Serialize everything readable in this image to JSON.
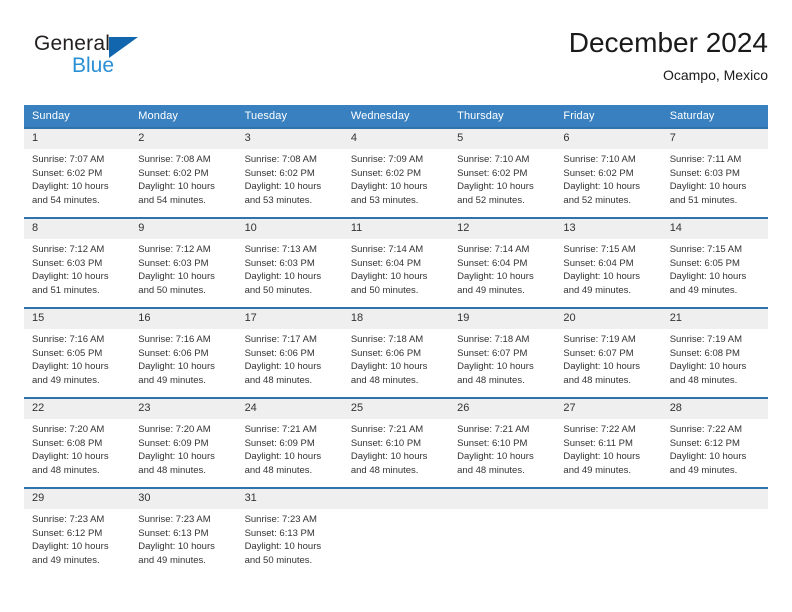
{
  "brand": {
    "name_top": "General",
    "name_bottom": "Blue",
    "triangle_color": "#1266ad",
    "blue_text_color": "#2a8fd4"
  },
  "header": {
    "title": "December 2024",
    "subtitle": "Ocampo, Mexico"
  },
  "theme": {
    "header_row_bg": "#3880c0",
    "cell_top_border": "#2f72ac",
    "daynum_bg": "#efefef",
    "text": "#333333"
  },
  "weekdays": [
    "Sunday",
    "Monday",
    "Tuesday",
    "Wednesday",
    "Thursday",
    "Friday",
    "Saturday"
  ],
  "weeks": [
    [
      {
        "day": "1",
        "sunrise": "Sunrise: 7:07 AM",
        "sunset": "Sunset: 6:02 PM",
        "daylight_1": "Daylight: 10 hours",
        "daylight_2": "and 54 minutes."
      },
      {
        "day": "2",
        "sunrise": "Sunrise: 7:08 AM",
        "sunset": "Sunset: 6:02 PM",
        "daylight_1": "Daylight: 10 hours",
        "daylight_2": "and 54 minutes."
      },
      {
        "day": "3",
        "sunrise": "Sunrise: 7:08 AM",
        "sunset": "Sunset: 6:02 PM",
        "daylight_1": "Daylight: 10 hours",
        "daylight_2": "and 53 minutes."
      },
      {
        "day": "4",
        "sunrise": "Sunrise: 7:09 AM",
        "sunset": "Sunset: 6:02 PM",
        "daylight_1": "Daylight: 10 hours",
        "daylight_2": "and 53 minutes."
      },
      {
        "day": "5",
        "sunrise": "Sunrise: 7:10 AM",
        "sunset": "Sunset: 6:02 PM",
        "daylight_1": "Daylight: 10 hours",
        "daylight_2": "and 52 minutes."
      },
      {
        "day": "6",
        "sunrise": "Sunrise: 7:10 AM",
        "sunset": "Sunset: 6:02 PM",
        "daylight_1": "Daylight: 10 hours",
        "daylight_2": "and 52 minutes."
      },
      {
        "day": "7",
        "sunrise": "Sunrise: 7:11 AM",
        "sunset": "Sunset: 6:03 PM",
        "daylight_1": "Daylight: 10 hours",
        "daylight_2": "and 51 minutes."
      }
    ],
    [
      {
        "day": "8",
        "sunrise": "Sunrise: 7:12 AM",
        "sunset": "Sunset: 6:03 PM",
        "daylight_1": "Daylight: 10 hours",
        "daylight_2": "and 51 minutes."
      },
      {
        "day": "9",
        "sunrise": "Sunrise: 7:12 AM",
        "sunset": "Sunset: 6:03 PM",
        "daylight_1": "Daylight: 10 hours",
        "daylight_2": "and 50 minutes."
      },
      {
        "day": "10",
        "sunrise": "Sunrise: 7:13 AM",
        "sunset": "Sunset: 6:03 PM",
        "daylight_1": "Daylight: 10 hours",
        "daylight_2": "and 50 minutes."
      },
      {
        "day": "11",
        "sunrise": "Sunrise: 7:14 AM",
        "sunset": "Sunset: 6:04 PM",
        "daylight_1": "Daylight: 10 hours",
        "daylight_2": "and 50 minutes."
      },
      {
        "day": "12",
        "sunrise": "Sunrise: 7:14 AM",
        "sunset": "Sunset: 6:04 PM",
        "daylight_1": "Daylight: 10 hours",
        "daylight_2": "and 49 minutes."
      },
      {
        "day": "13",
        "sunrise": "Sunrise: 7:15 AM",
        "sunset": "Sunset: 6:04 PM",
        "daylight_1": "Daylight: 10 hours",
        "daylight_2": "and 49 minutes."
      },
      {
        "day": "14",
        "sunrise": "Sunrise: 7:15 AM",
        "sunset": "Sunset: 6:05 PM",
        "daylight_1": "Daylight: 10 hours",
        "daylight_2": "and 49 minutes."
      }
    ],
    [
      {
        "day": "15",
        "sunrise": "Sunrise: 7:16 AM",
        "sunset": "Sunset: 6:05 PM",
        "daylight_1": "Daylight: 10 hours",
        "daylight_2": "and 49 minutes."
      },
      {
        "day": "16",
        "sunrise": "Sunrise: 7:16 AM",
        "sunset": "Sunset: 6:06 PM",
        "daylight_1": "Daylight: 10 hours",
        "daylight_2": "and 49 minutes."
      },
      {
        "day": "17",
        "sunrise": "Sunrise: 7:17 AM",
        "sunset": "Sunset: 6:06 PM",
        "daylight_1": "Daylight: 10 hours",
        "daylight_2": "and 48 minutes."
      },
      {
        "day": "18",
        "sunrise": "Sunrise: 7:18 AM",
        "sunset": "Sunset: 6:06 PM",
        "daylight_1": "Daylight: 10 hours",
        "daylight_2": "and 48 minutes."
      },
      {
        "day": "19",
        "sunrise": "Sunrise: 7:18 AM",
        "sunset": "Sunset: 6:07 PM",
        "daylight_1": "Daylight: 10 hours",
        "daylight_2": "and 48 minutes."
      },
      {
        "day": "20",
        "sunrise": "Sunrise: 7:19 AM",
        "sunset": "Sunset: 6:07 PM",
        "daylight_1": "Daylight: 10 hours",
        "daylight_2": "and 48 minutes."
      },
      {
        "day": "21",
        "sunrise": "Sunrise: 7:19 AM",
        "sunset": "Sunset: 6:08 PM",
        "daylight_1": "Daylight: 10 hours",
        "daylight_2": "and 48 minutes."
      }
    ],
    [
      {
        "day": "22",
        "sunrise": "Sunrise: 7:20 AM",
        "sunset": "Sunset: 6:08 PM",
        "daylight_1": "Daylight: 10 hours",
        "daylight_2": "and 48 minutes."
      },
      {
        "day": "23",
        "sunrise": "Sunrise: 7:20 AM",
        "sunset": "Sunset: 6:09 PM",
        "daylight_1": "Daylight: 10 hours",
        "daylight_2": "and 48 minutes."
      },
      {
        "day": "24",
        "sunrise": "Sunrise: 7:21 AM",
        "sunset": "Sunset: 6:09 PM",
        "daylight_1": "Daylight: 10 hours",
        "daylight_2": "and 48 minutes."
      },
      {
        "day": "25",
        "sunrise": "Sunrise: 7:21 AM",
        "sunset": "Sunset: 6:10 PM",
        "daylight_1": "Daylight: 10 hours",
        "daylight_2": "and 48 minutes."
      },
      {
        "day": "26",
        "sunrise": "Sunrise: 7:21 AM",
        "sunset": "Sunset: 6:10 PM",
        "daylight_1": "Daylight: 10 hours",
        "daylight_2": "and 48 minutes."
      },
      {
        "day": "27",
        "sunrise": "Sunrise: 7:22 AM",
        "sunset": "Sunset: 6:11 PM",
        "daylight_1": "Daylight: 10 hours",
        "daylight_2": "and 49 minutes."
      },
      {
        "day": "28",
        "sunrise": "Sunrise: 7:22 AM",
        "sunset": "Sunset: 6:12 PM",
        "daylight_1": "Daylight: 10 hours",
        "daylight_2": "and 49 minutes."
      }
    ],
    [
      {
        "day": "29",
        "sunrise": "Sunrise: 7:23 AM",
        "sunset": "Sunset: 6:12 PM",
        "daylight_1": "Daylight: 10 hours",
        "daylight_2": "and 49 minutes."
      },
      {
        "day": "30",
        "sunrise": "Sunrise: 7:23 AM",
        "sunset": "Sunset: 6:13 PM",
        "daylight_1": "Daylight: 10 hours",
        "daylight_2": "and 49 minutes."
      },
      {
        "day": "31",
        "sunrise": "Sunrise: 7:23 AM",
        "sunset": "Sunset: 6:13 PM",
        "daylight_1": "Daylight: 10 hours",
        "daylight_2": "and 50 minutes."
      },
      {
        "day": "",
        "sunrise": "",
        "sunset": "",
        "daylight_1": "",
        "daylight_2": ""
      },
      {
        "day": "",
        "sunrise": "",
        "sunset": "",
        "daylight_1": "",
        "daylight_2": ""
      },
      {
        "day": "",
        "sunrise": "",
        "sunset": "",
        "daylight_1": "",
        "daylight_2": ""
      },
      {
        "day": "",
        "sunrise": "",
        "sunset": "",
        "daylight_1": "",
        "daylight_2": ""
      }
    ]
  ]
}
